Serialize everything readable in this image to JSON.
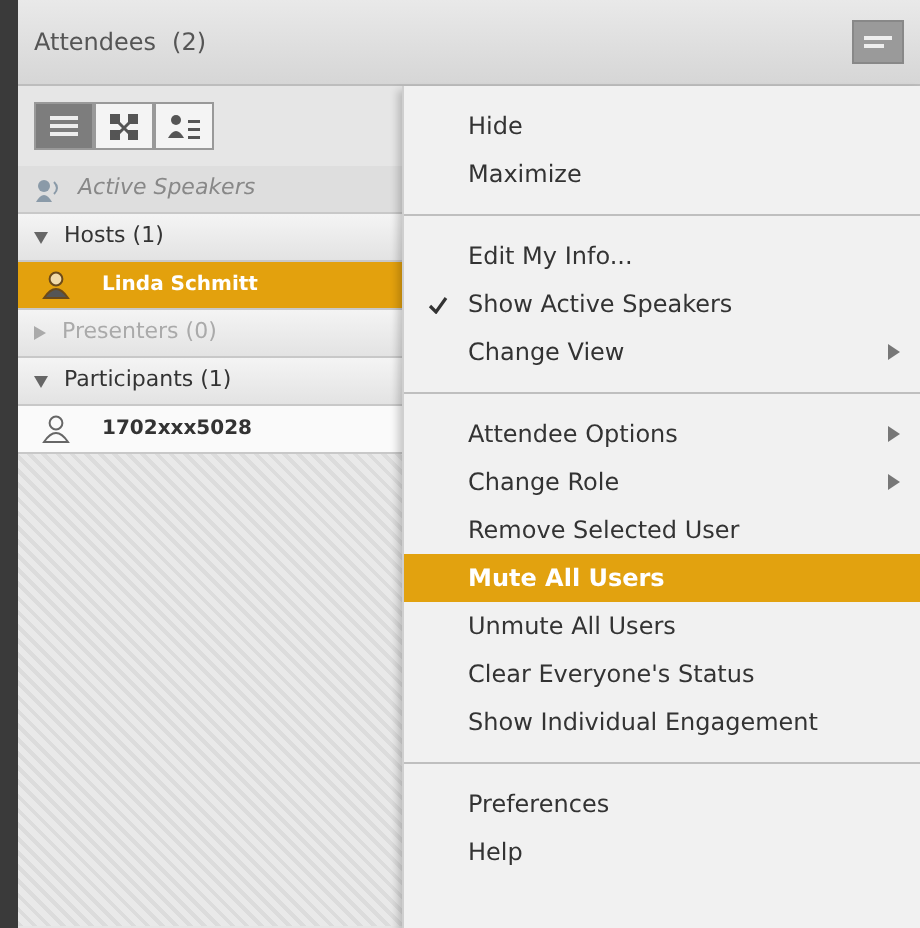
{
  "panel": {
    "title": "Attendees",
    "count": "(2)"
  },
  "view_buttons": [
    {
      "kind": "list",
      "selected": true
    },
    {
      "kind": "grid",
      "selected": false
    },
    {
      "kind": "sort",
      "selected": false
    }
  ],
  "active_speakers": "Active Speakers",
  "groups": [
    {
      "label": "Hosts (1)",
      "expanded": true,
      "disabled": false,
      "users": [
        {
          "name": "Linda Schmitt",
          "selected": true,
          "kind": "host"
        }
      ]
    },
    {
      "label": "Presenters (0)",
      "expanded": false,
      "disabled": true
    },
    {
      "label": "Participants (1)",
      "expanded": true,
      "disabled": false,
      "users": [
        {
          "name": "1702xxx5028",
          "selected": false,
          "kind": "participant"
        }
      ]
    }
  ],
  "menu": [
    [
      {
        "label": "Hide",
        "checked": false,
        "submenu": false,
        "selected": false
      },
      {
        "label": "Maximize",
        "checked": false,
        "submenu": false,
        "selected": false
      }
    ],
    [
      {
        "label": "Edit My Info...",
        "checked": false,
        "submenu": false,
        "selected": false
      },
      {
        "label": "Show Active Speakers",
        "checked": true,
        "submenu": false,
        "selected": false
      },
      {
        "label": "Change View",
        "checked": false,
        "submenu": true,
        "selected": false
      }
    ],
    [
      {
        "label": "Attendee Options",
        "checked": false,
        "submenu": true,
        "selected": false
      },
      {
        "label": "Change Role",
        "checked": false,
        "submenu": true,
        "selected": false
      },
      {
        "label": "Remove Selected User",
        "checked": false,
        "submenu": false,
        "selected": false
      },
      {
        "label": "Mute All Users",
        "checked": false,
        "submenu": false,
        "selected": true
      },
      {
        "label": "Unmute All Users",
        "checked": false,
        "submenu": false,
        "selected": false
      },
      {
        "label": "Clear Everyone's Status",
        "checked": false,
        "submenu": false,
        "selected": false
      },
      {
        "label": "Show Individual Engagement",
        "checked": false,
        "submenu": false,
        "selected": false
      }
    ],
    [
      {
        "label": "Preferences",
        "checked": false,
        "submenu": false,
        "selected": false
      },
      {
        "label": "Help",
        "checked": false,
        "submenu": false,
        "selected": false
      }
    ]
  ]
}
